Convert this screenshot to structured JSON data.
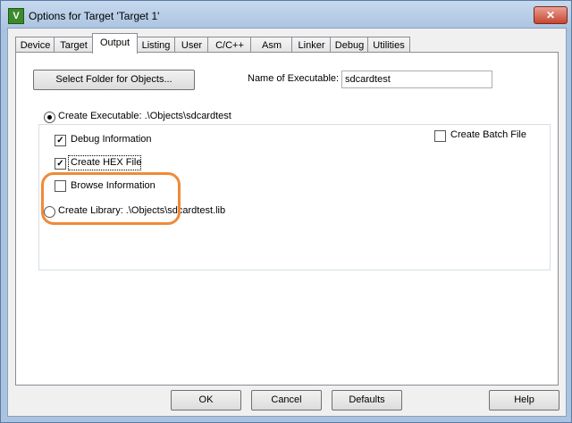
{
  "window": {
    "title": "Options for Target 'Target 1'",
    "close_glyph": "✕",
    "icon_letter": "V"
  },
  "tabs": [
    "Device",
    "Target",
    "Output",
    "Listing",
    "User",
    "C/C++",
    "Asm",
    "Linker",
    "Debug",
    "Utilities"
  ],
  "output": {
    "select_folder_label": "Select Folder for Objects...",
    "name_of_executable_label": "Name of Executable:",
    "name_of_executable_value": "sdcardtest",
    "create_executable_label": "Create Executable:  .\\Objects\\sdcardtest",
    "create_executable_selected": true,
    "debug_information_label": "Debug Information",
    "debug_information_checked": true,
    "create_hex_label": "Create HEX File",
    "create_hex_checked": true,
    "browse_information_label": "Browse Information",
    "browse_information_checked": false,
    "create_library_label": "Create Library:  .\\Objects\\sdcardtest.lib",
    "create_library_selected": false,
    "create_batch_label": "Create Batch File",
    "create_batch_checked": false,
    "highlight_color": "#f08a38"
  },
  "buttons": {
    "ok": "OK",
    "cancel": "Cancel",
    "defaults": "Defaults",
    "help": "Help"
  }
}
